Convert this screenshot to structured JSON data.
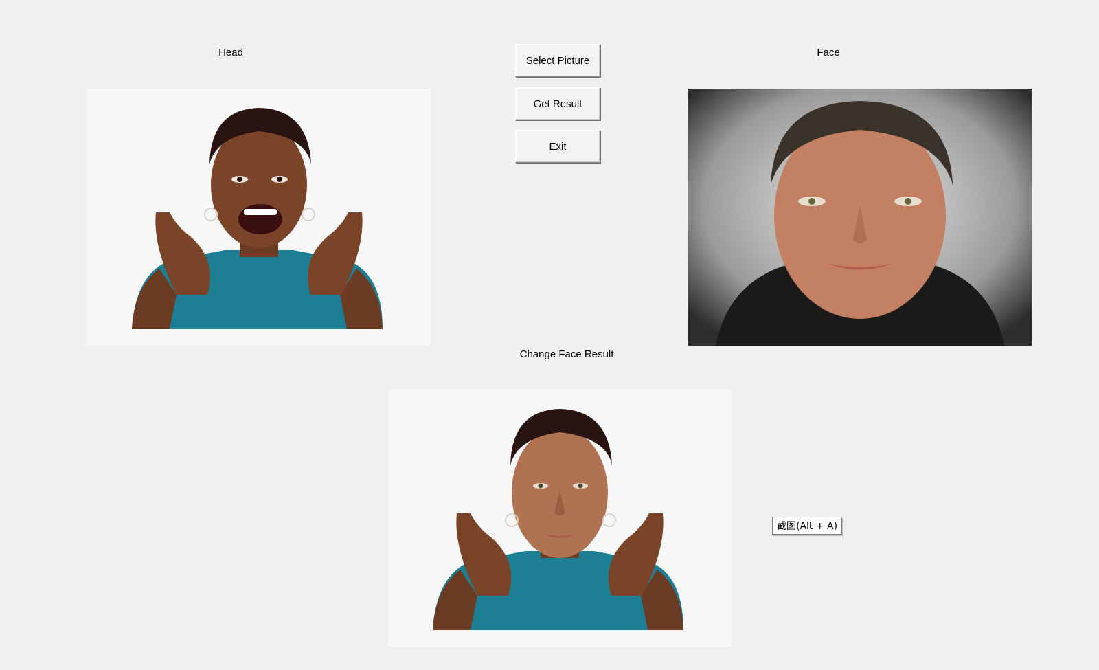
{
  "labels": {
    "head": "Head",
    "face": "Face",
    "result": "Change Face Result"
  },
  "buttons": {
    "select": "Select Picture",
    "get_result": "Get Result",
    "exit": "Exit"
  },
  "tooltip": "截图(Alt + A)",
  "images": {
    "head": "woman-smiling-photo",
    "face": "man-portrait-photo",
    "result": "face-swap-result-photo"
  }
}
